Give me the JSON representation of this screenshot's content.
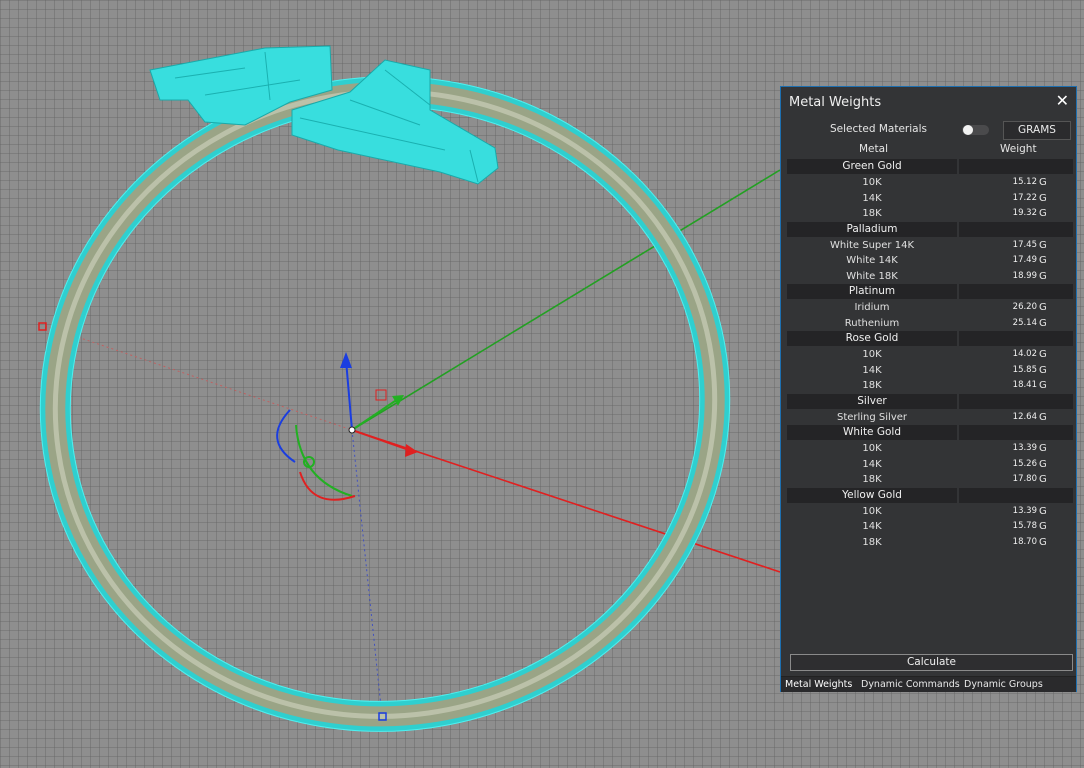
{
  "panel": {
    "title": "Metal Weights",
    "close_icon": "close-icon",
    "selected_materials_label": "Selected Materials",
    "unit_button": "GRAMS",
    "col_metal": "Metal",
    "col_weight": "Weight",
    "groups": [
      {
        "name": "Green Gold",
        "rows": [
          {
            "metal": "10K",
            "weight": "15.12",
            "unit": "G"
          },
          {
            "metal": "14K",
            "weight": "17.22",
            "unit": "G"
          },
          {
            "metal": "18K",
            "weight": "19.32",
            "unit": "G"
          }
        ]
      },
      {
        "name": "Palladium",
        "rows": [
          {
            "metal": "White Super 14K",
            "weight": "17.45",
            "unit": "G"
          },
          {
            "metal": "White 14K",
            "weight": "17.49",
            "unit": "G"
          },
          {
            "metal": "White 18K",
            "weight": "18.99",
            "unit": "G"
          }
        ]
      },
      {
        "name": "Platinum",
        "rows": [
          {
            "metal": "Iridium",
            "weight": "26.20",
            "unit": "G"
          },
          {
            "metal": "Ruthenium",
            "weight": "25.14",
            "unit": "G"
          }
        ]
      },
      {
        "name": "Rose Gold",
        "rows": [
          {
            "metal": "10K",
            "weight": "14.02",
            "unit": "G"
          },
          {
            "metal": "14K",
            "weight": "15.85",
            "unit": "G"
          },
          {
            "metal": "18K",
            "weight": "18.41",
            "unit": "G"
          }
        ]
      },
      {
        "name": "Silver",
        "rows": [
          {
            "metal": "Sterling Silver",
            "weight": "12.64",
            "unit": "G"
          }
        ]
      },
      {
        "name": "White Gold",
        "rows": [
          {
            "metal": "10K",
            "weight": "13.39",
            "unit": "G"
          },
          {
            "metal": "14K",
            "weight": "15.26",
            "unit": "G"
          },
          {
            "metal": "18K",
            "weight": "17.80",
            "unit": "G"
          }
        ]
      },
      {
        "name": "Yellow Gold",
        "rows": [
          {
            "metal": "10K",
            "weight": "13.39",
            "unit": "G"
          },
          {
            "metal": "14K",
            "weight": "15.78",
            "unit": "G"
          },
          {
            "metal": "18K",
            "weight": "18.70",
            "unit": "G"
          }
        ]
      }
    ],
    "calculate_button": "Calculate",
    "tabs": [
      "Metal Weights",
      "Dynamic Commands",
      "Dynamic Groups"
    ]
  },
  "colors": {
    "viewport_bg": "#8a8a8a",
    "grid_line": "#3a3a3a",
    "ring_selected": "#40e0e0",
    "ring_body": "#8f9a7a",
    "axis_x": "#e02020",
    "axis_y": "#20b020",
    "axis_z": "#1a3de0",
    "panel_bg": "#333436",
    "panel_border": "#1d6fb0"
  }
}
